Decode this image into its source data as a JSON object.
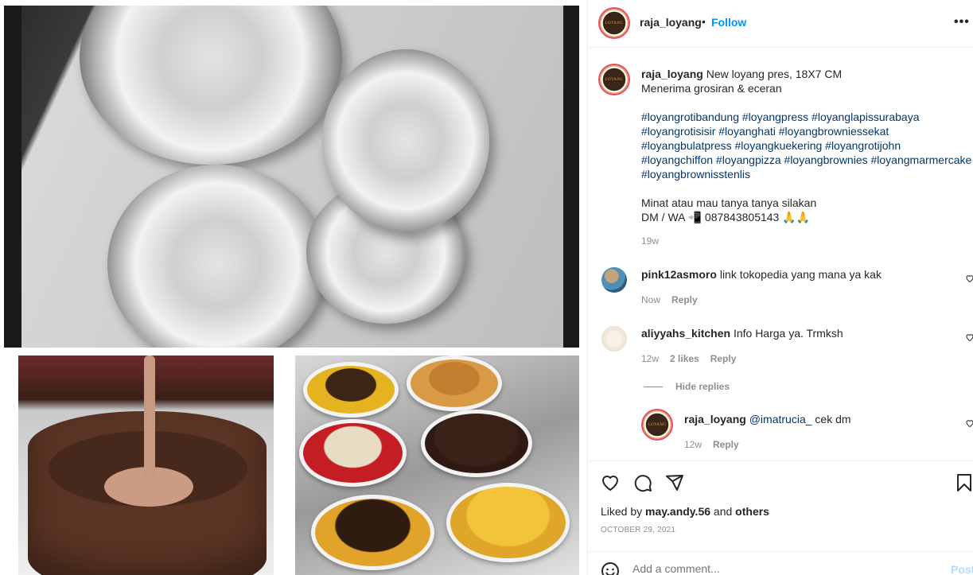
{
  "post": {
    "username": "raja_loyang",
    "dot": "•",
    "follow_label": "Follow",
    "more_label": "•••"
  },
  "caption": {
    "username": "raja_loyang",
    "line1": "New loyang pres, 18X7 CM",
    "line2": "Menerima grosiran & eceran",
    "hashtags": [
      "#loyangrotibandung #loyangpress #loyanglapissurabaya",
      "#loyangrotisisir #loyanghati #loyangbrowniessekat",
      "#loyangbulatpress #loyangkuekering #loyangrotijohn",
      "#loyangchiffon #loyangpizza #loyangbrownies #loyangmarmercake",
      "#loyangbrownisstenlis"
    ],
    "contact1": "Minat atau mau tanya tanya silakan",
    "contact2": "DM / WA 📲 087843805143 🙏🙏",
    "time": "19w"
  },
  "comments": [
    {
      "username": "pink12asmoro",
      "text": "link tokopedia yang mana ya kak",
      "time": "Now",
      "likes": "",
      "reply": "Reply"
    },
    {
      "username": "aliyyahs_kitchen",
      "text": "Info Harga ya. Trmksh",
      "time": "12w",
      "likes": "2 likes",
      "reply": "Reply"
    }
  ],
  "hide_replies": "Hide replies",
  "reply": {
    "username": "raja_loyang",
    "mention": "@imatrucia_",
    "text": "cek dm",
    "time": "12w",
    "reply": "Reply"
  },
  "likes": {
    "prefix": "Liked by",
    "user": "may.andy.56",
    "and": "and",
    "others": "others"
  },
  "date": "OCTOBER 29, 2021",
  "add_comment": {
    "placeholder": "Add a comment...",
    "post": "Post"
  },
  "colors": {
    "link_blue": "#0095f6",
    "hashtag": "#00376b",
    "muted": "#8e8e8e",
    "story_ring": "#e84b78"
  }
}
